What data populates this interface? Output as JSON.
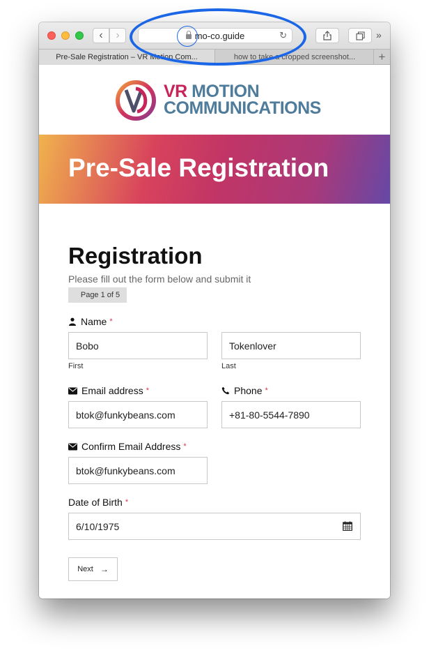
{
  "browser": {
    "url": "mo-co.guide",
    "tabs": [
      {
        "label": "Pre-Sale Registration – VR Motion Com..."
      },
      {
        "label": "how to take a cropped screenshot..."
      }
    ],
    "more_label": "»"
  },
  "logo": {
    "line1_vr": "VR",
    "line1_rest": " MOTION",
    "line2": "COMMUNICATIONS"
  },
  "banner": {
    "title": "Pre-Sale Registration"
  },
  "form": {
    "heading": "Registration",
    "subtitle": "Please fill out the form below and submit it",
    "page_indicator": "Page 1 of 5",
    "name": {
      "label": "Name",
      "first_value": "Bobo",
      "first_hint": "First",
      "last_value": "Tokenlover",
      "last_hint": "Last"
    },
    "email": {
      "label": "Email address",
      "value": "btok@funkybeans.com"
    },
    "phone": {
      "label": "Phone",
      "value": "+81-80-5544-7890"
    },
    "confirm_email": {
      "label": "Confirm Email Address",
      "value": "btok@funkybeans.com"
    },
    "dob": {
      "label": "Date of Birth",
      "value": "6/10/1975"
    },
    "required_mark": "*",
    "next_label": "Next",
    "next_arrow": "→"
  },
  "colors": {
    "accent": "#c7245a",
    "brand_blue": "#4f7c9b",
    "annotation": "#1a66e6",
    "required": "#d2384f"
  }
}
